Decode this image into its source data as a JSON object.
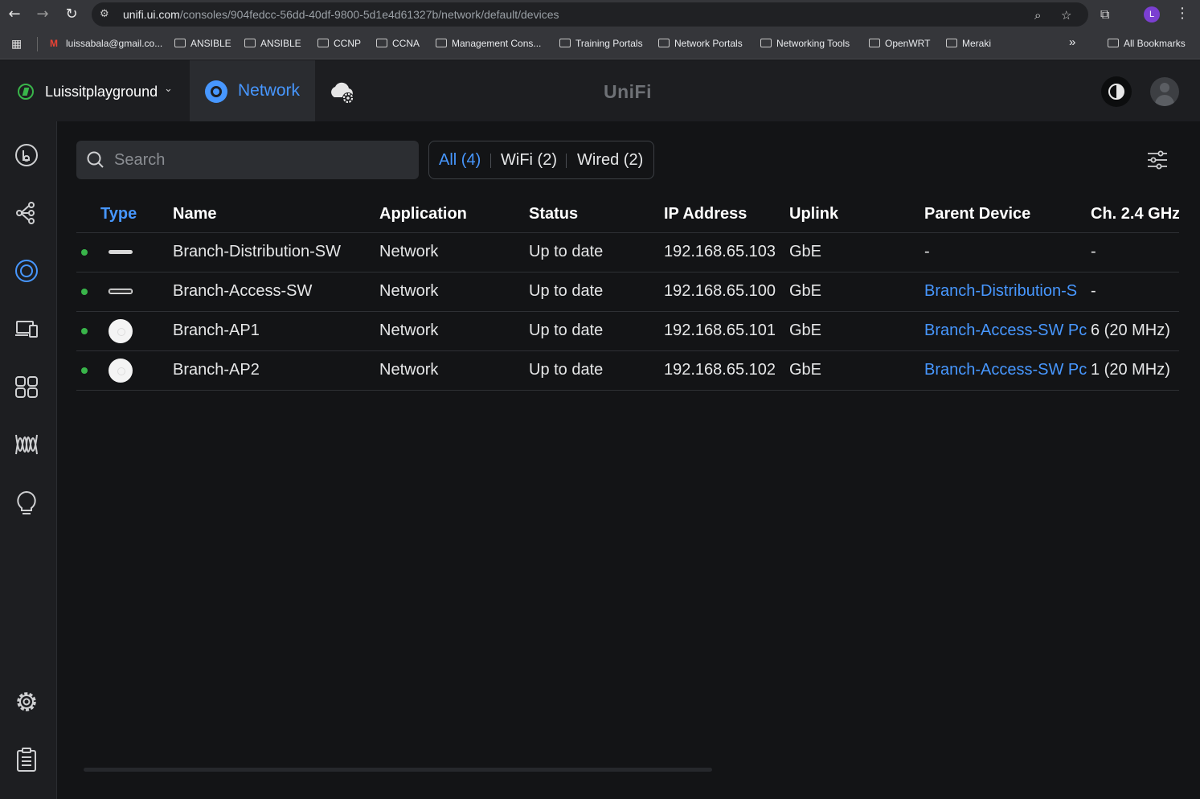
{
  "browser": {
    "url_host": "unifi.ui.com",
    "url_path": "/consoles/904fedcc-56dd-40df-9800-5d1e4d61327b/network/default/devices",
    "profile_initial": "L",
    "bookmarks": [
      {
        "label": "luissabala@gmail.co...",
        "kind": "gmail"
      },
      {
        "label": "ANSIBLE",
        "kind": "folder"
      },
      {
        "label": "ANSIBLE",
        "kind": "folder"
      },
      {
        "label": "CCNP",
        "kind": "folder"
      },
      {
        "label": "CCNA",
        "kind": "folder"
      },
      {
        "label": "Management Cons...",
        "kind": "folder"
      },
      {
        "label": "Training Portals",
        "kind": "folder"
      },
      {
        "label": "Network Portals",
        "kind": "folder"
      },
      {
        "label": "Networking Tools",
        "kind": "folder"
      },
      {
        "label": "OpenWRT",
        "kind": "folder"
      },
      {
        "label": "Meraki",
        "kind": "folder"
      }
    ],
    "overflow_label": "»",
    "all_bookmarks": "All Bookmarks"
  },
  "header": {
    "site_name": "Luissitplayground",
    "active_app": "Network",
    "logo": "UniFi"
  },
  "search": {
    "placeholder": "Search",
    "value": ""
  },
  "filters": [
    {
      "label": "All (4)",
      "active": true
    },
    {
      "label": "WiFi (2)",
      "active": false
    },
    {
      "label": "Wired (2)",
      "active": false
    }
  ],
  "table": {
    "columns": [
      "Type",
      "Name",
      "Application",
      "Status",
      "IP Address",
      "Uplink",
      "Parent Device",
      "Ch. 2.4 GHz"
    ],
    "sorted_column": "Type",
    "rows": [
      {
        "icon": "switch",
        "name": "Branch-Distribution-SW",
        "application": "Network",
        "status": "Up to date",
        "ip": "192.168.65.103",
        "uplink": "GbE",
        "parent": "-",
        "parent_link": false,
        "channel": "-"
      },
      {
        "icon": "switch-thick",
        "name": "Branch-Access-SW",
        "application": "Network",
        "status": "Up to date",
        "ip": "192.168.65.100",
        "uplink": "GbE",
        "parent": "Branch-Distribution-S",
        "parent_link": true,
        "channel": "-"
      },
      {
        "icon": "access-point",
        "name": "Branch-AP1",
        "application": "Network",
        "status": "Up to date",
        "ip": "192.168.65.101",
        "uplink": "GbE",
        "parent": "Branch-Access-SW Pc",
        "parent_link": true,
        "channel": "6 (20 MHz)"
      },
      {
        "icon": "access-point",
        "name": "Branch-AP2",
        "application": "Network",
        "status": "Up to date",
        "ip": "192.168.65.102",
        "uplink": "GbE",
        "parent": "Branch-Access-SW Pc",
        "parent_link": true,
        "channel": "1 (20 MHz)"
      }
    ]
  },
  "colors": {
    "accent": "#4797ff",
    "online": "#39b54a",
    "background": "#131416",
    "panel": "#1d1e21"
  }
}
